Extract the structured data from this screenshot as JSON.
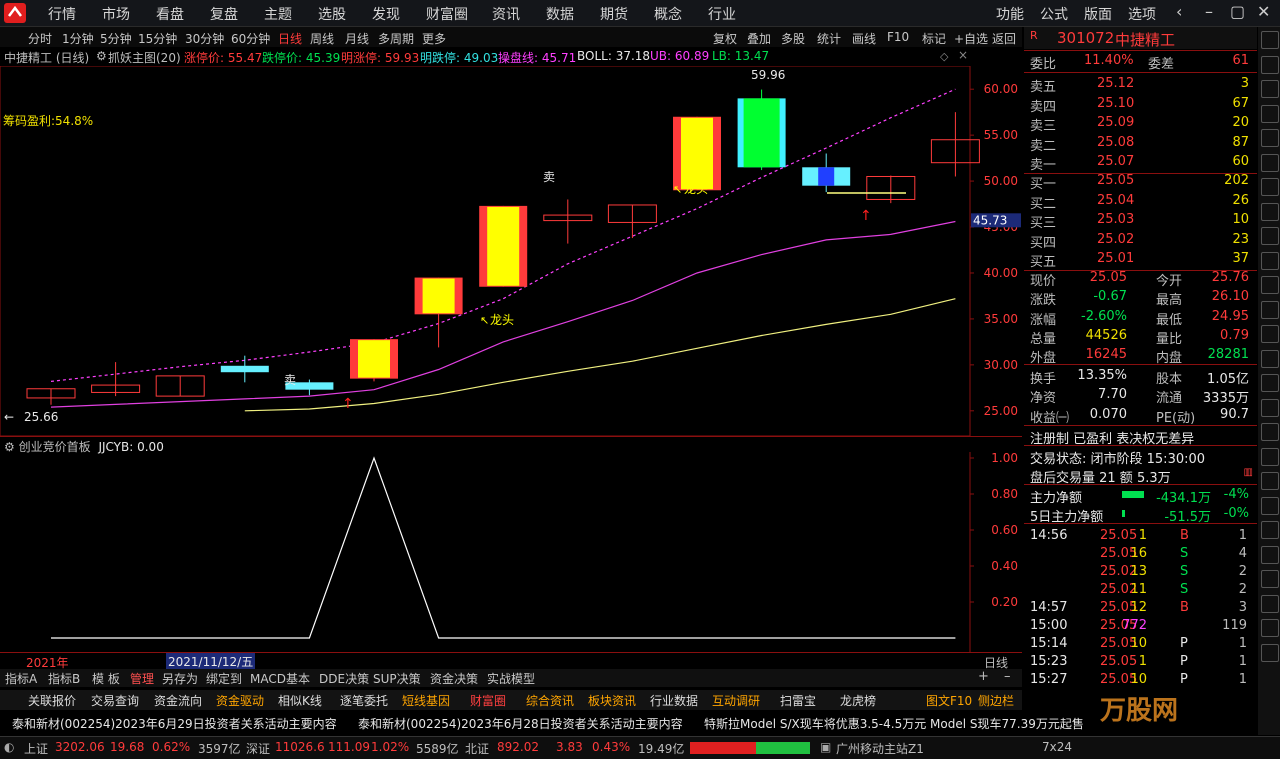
{
  "menu": {
    "items": [
      "行情",
      "市场",
      "看盘",
      "复盘",
      "主题",
      "选股",
      "发现",
      "财富圈",
      "资讯",
      "数据",
      "期货",
      "概念",
      "行业"
    ],
    "right_items": [
      "功能",
      "公式",
      "版面",
      "选项"
    ]
  },
  "periods": [
    "分时",
    "1分钟",
    "5分钟",
    "15分钟",
    "30分钟",
    "60分钟",
    "日线",
    "周线",
    "月线",
    "多周期",
    "更多"
  ],
  "active_period": "日线",
  "toolbar": [
    "复权",
    "叠加",
    "多股",
    "统计",
    "画线",
    "F10",
    "标记",
    "+自选",
    "返回"
  ],
  "info": {
    "stock": "中捷精工 (日线)",
    "indicator": "抓妖主图(20)",
    "limit_up": "涨停价: 55.47",
    "limit_down": "跌停价: 45.39",
    "tmr_up": "明涨停: 59.93",
    "tmr_down": "明跌停: 49.03",
    "pan": "操盘线: 45.71",
    "boll": "BOLL: 37.18",
    "ub": "UB: 60.89",
    "lb": "LB: 13.47"
  },
  "chips_profit": "筹码盈利:54.8%",
  "chart_data": {
    "type": "candlestick",
    "ylim": [
      24,
      61
    ],
    "y_ticks": [
      "60.00",
      "55.00",
      "50.00",
      "45.00",
      "40.00",
      "35.00",
      "30.00",
      "25.00"
    ],
    "candles": [
      {
        "open": 26.4,
        "close": 27.4,
        "high": 27.4,
        "low": 25.66,
        "fill": "none"
      },
      {
        "open": 27.0,
        "close": 27.8,
        "high": 30.3,
        "low": 26.6,
        "fill": "none"
      },
      {
        "open": 26.6,
        "close": 28.8,
        "high": 28.8,
        "low": 26.6,
        "fill": "none"
      },
      {
        "open": 29.2,
        "close": 29.9,
        "high": 31.0,
        "low": 28.1,
        "fill": "cyan"
      },
      {
        "open": 27.3,
        "close": 28.1,
        "high": 28.4,
        "low": 26.7,
        "fill": "cyan"
      },
      {
        "open": 28.5,
        "close": 32.8,
        "high": 32.8,
        "low": 28.2,
        "fill": "yellow"
      },
      {
        "open": 35.5,
        "close": 39.5,
        "high": 39.5,
        "low": 31.9,
        "fill": "yellow"
      },
      {
        "open": 38.5,
        "close": 47.3,
        "high": 47.3,
        "low": 38.5,
        "fill": "yellow"
      },
      {
        "open": 45.7,
        "close": 46.3,
        "high": 48.0,
        "low": 43.2,
        "fill": "none"
      },
      {
        "open": 45.5,
        "close": 47.4,
        "high": 47.4,
        "low": 43.8,
        "fill": "none"
      },
      {
        "open": 49.0,
        "close": 57.0,
        "high": 57.0,
        "low": 49.0,
        "fill": "yellow"
      },
      {
        "open": 51.5,
        "close": 59.0,
        "high": 59.96,
        "low": 51.2,
        "fill": "green"
      },
      {
        "open": 49.5,
        "close": 51.5,
        "high": 53.0,
        "low": 48.8,
        "fill": "cyan"
      },
      {
        "open": 48.0,
        "close": 50.5,
        "high": 50.6,
        "low": 47.6,
        "fill": "none"
      },
      {
        "open": 52.0,
        "close": 54.5,
        "high": 57.5,
        "low": 50.5,
        "fill": "none"
      }
    ],
    "ma_magenta": [
      25.4,
      25.7,
      26.0,
      26.3,
      26.6,
      27.3,
      29.5,
      32.5,
      34.7,
      37.0,
      40.0,
      42.0,
      43.6,
      44.2,
      45.6
    ],
    "ma_yellow": [
      null,
      null,
      null,
      25.0,
      25.2,
      25.8,
      26.8,
      28.1,
      29.3,
      30.4,
      31.8,
      33.2,
      34.4,
      35.5,
      37.2
    ],
    "ub_dash": [
      28.2,
      29.0,
      29.8,
      30.5,
      31.4,
      32.4,
      34.5,
      37.2,
      41.0,
      44.0,
      47.0,
      50.4,
      53.6,
      56.9,
      60.0
    ],
    "labels": {
      "low": "25.66",
      "high": "59.96",
      "price_tag": "45.73",
      "sell": "卖",
      "dragon": "龙头"
    }
  },
  "sub": {
    "title": "创业竞价首板",
    "value": "JJCYB: 0.00",
    "y_ticks": [
      "1.00",
      "0.80",
      "0.60",
      "0.40",
      "0.20"
    ],
    "series": [
      0,
      0,
      0,
      0,
      0,
      1,
      0,
      0,
      0,
      0,
      0,
      0,
      0,
      0,
      0
    ]
  },
  "dates": {
    "year": "2021年",
    "cursor": "2021/11/12/五"
  },
  "bottom_tabs": [
    "指标A",
    "指标B",
    "模 板",
    "管理",
    "另存为",
    "绑定到",
    "MACD基本",
    "DDE决策",
    "SUP决策",
    "资金决策",
    "实战模型"
  ],
  "func_tabs": [
    "关联报价",
    "交易查询",
    "资金流向",
    "资金驱动",
    "相似K线",
    "逐笔委托",
    "短线基因",
    "财富圈",
    "综合资讯",
    "板块资讯",
    "行业数据",
    "互动调研",
    "扫雷宝",
    "龙虎榜",
    "图文F10",
    "侧边栏"
  ],
  "news": [
    "泰和新材(002254)2023年6月29日投资者关系活动主要内容",
    "泰和新材(002254)2023年6月28日投资者关系活动主要内容",
    "特斯拉Model S/X现车将优惠3.5-4.5万元 Model S现车77.39万元起售"
  ],
  "status": {
    "sh_label": "上证",
    "sh": "3202.06",
    "sh_chg": "19.68",
    "sh_pct": "0.62%",
    "sh_vol": "3597亿",
    "sz_label": "深证",
    "sz": "11026.6",
    "sz_chg": "111.09",
    "sz_pct": "1.02%",
    "sz_vol": "5589亿",
    "bz_label": "北证",
    "bz": "892.02",
    "bz_chg": "3.83",
    "bz_pct": "0.43%",
    "bz_vol": "19.49亿",
    "site": "广州移动主站Z1",
    "mode": "7x24"
  },
  "quote": {
    "code": "301072",
    "name": "中捷精工",
    "ratio_label": "委比",
    "ratio": "11.40%",
    "diff_label": "委差",
    "diff": "61",
    "sells": [
      [
        "卖五",
        "25.12",
        "3"
      ],
      [
        "卖四",
        "25.10",
        "67"
      ],
      [
        "卖三",
        "25.09",
        "20"
      ],
      [
        "卖二",
        "25.08",
        "87"
      ],
      [
        "卖一",
        "25.07",
        "60"
      ]
    ],
    "buys": [
      [
        "买一",
        "25.05",
        "202"
      ],
      [
        "买二",
        "25.04",
        "26"
      ],
      [
        "买三",
        "25.03",
        "10"
      ],
      [
        "买四",
        "25.02",
        "23"
      ],
      [
        "买五",
        "25.01",
        "37"
      ]
    ],
    "stats": [
      [
        "现价",
        "25.05",
        "今开",
        "25.76"
      ],
      [
        "涨跌",
        "-0.67",
        "最高",
        "26.10"
      ],
      [
        "涨幅",
        "-2.60%",
        "最低",
        "24.95"
      ],
      [
        "总量",
        "44526",
        "量比",
        "0.79"
      ],
      [
        "外盘",
        "16245",
        "内盘",
        "28281"
      ],
      [
        "换手",
        "13.35%",
        "股本",
        "1.05亿"
      ],
      [
        "净资",
        "7.70",
        "流通",
        "3335万"
      ],
      [
        "收益㈠",
        "0.070",
        "PE(动)",
        "90.7"
      ]
    ],
    "tags": "注册制 已盈利 表决权无差异",
    "trade_state": "交易状态: 闭市阶段 15:30:00",
    "after_trade": "盘后交易量 21 额 5.3万",
    "main_net_label": "主力净额",
    "main_net": "-434.1万",
    "main_net_pct": "-4%",
    "main5_label": "5日主力净额",
    "main5": "-51.5万",
    "main5_pct": "-0%",
    "ticks": [
      [
        "14:56",
        "25.05",
        "1",
        "B",
        "1"
      ],
      [
        "",
        "25.05",
        "16",
        "S",
        "4"
      ],
      [
        "",
        "25.02",
        "13",
        "S",
        "2"
      ],
      [
        "",
        "25.02",
        "11",
        "S",
        "2"
      ],
      [
        "14:57",
        "25.05",
        "12",
        "B",
        "3"
      ],
      [
        "15:00",
        "25.05",
        "772",
        "",
        "119"
      ],
      [
        "15:14",
        "25.05",
        "10",
        "P",
        "1"
      ],
      [
        "15:23",
        "25.05",
        "1",
        "P",
        "1"
      ],
      [
        "15:27",
        "25.05",
        "10",
        "P",
        "1"
      ]
    ]
  },
  "colors": {
    "up": "#ff3b3b",
    "down": "#00e050",
    "bg": "#000000",
    "grid": "#8a0f0f"
  }
}
